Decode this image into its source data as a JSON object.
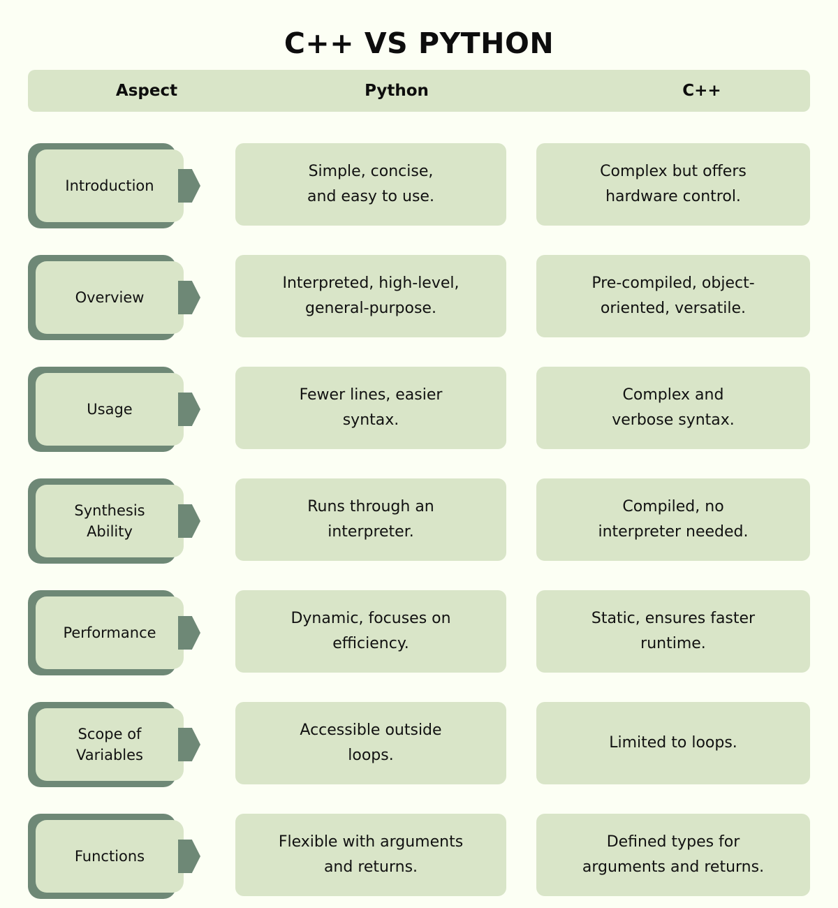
{
  "title": "C++ VS PYTHON",
  "colors": {
    "background": "#fcfff4",
    "card_fill": "#d9e5c8",
    "accent_shadow": "#6e8876",
    "text": "#111111"
  },
  "header": {
    "aspect": "Aspect",
    "python": "Python",
    "cpp": "C++"
  },
  "rows": [
    {
      "aspect": "Introduction",
      "python": "Simple, concise,\nand easy to use.",
      "cpp": "Complex but offers\nhardware control."
    },
    {
      "aspect": "Overview",
      "python": "Interpreted, high-level,\ngeneral-purpose.",
      "cpp": "Pre-compiled, object-\noriented, versatile."
    },
    {
      "aspect": "Usage",
      "python": "Fewer lines, easier\nsyntax.",
      "cpp": "Complex and\nverbose syntax."
    },
    {
      "aspect": "Synthesis\nAbility",
      "python": "Runs through an\ninterpreter.",
      "cpp": "Compiled, no\ninterpreter needed."
    },
    {
      "aspect": "Performance",
      "python": "Dynamic, focuses on\nefficiency.",
      "cpp": "Static, ensures faster\nruntime."
    },
    {
      "aspect": "Scope of\nVariables",
      "python": "Accessible outside\nloops.",
      "cpp": "Limited to loops."
    },
    {
      "aspect": "Functions",
      "python": "Flexible with arguments\nand returns.",
      "cpp": "Defined types for\narguments and returns."
    }
  ]
}
